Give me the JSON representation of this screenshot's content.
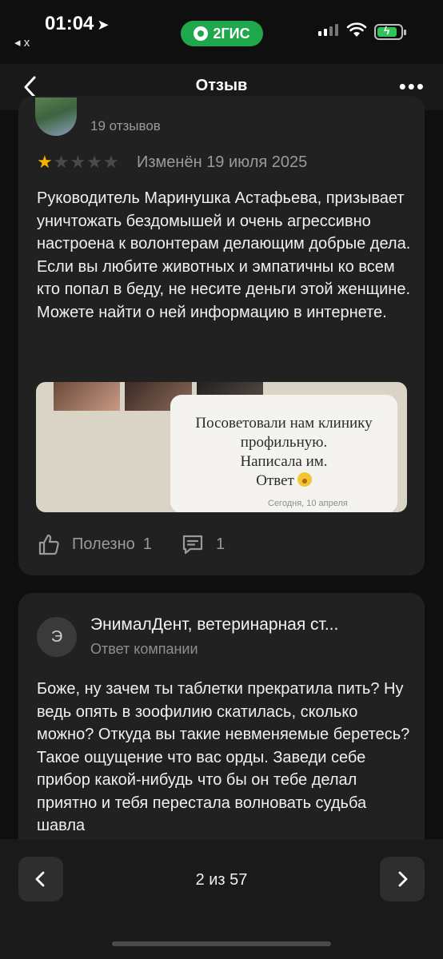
{
  "status_bar": {
    "time": "01:04",
    "back_app": "◂ x",
    "app_badge": "2ГИС"
  },
  "navbar": {
    "title": "Отзыв"
  },
  "review": {
    "reviews_count": "19 отзывов",
    "rating": 1,
    "rating_max": 5,
    "edited": "Изменён 19 июля 2025",
    "text": "Руководитель Маринушка Астафьева, призывает уничтожать бездомышей и очень агрессивно настроена к волонтерам делающим добрые дела. Если вы любите животных и эмпатичны ко всем кто попал в беду, не несите деньги этой женщине. Можете найти о ней информацию в интернете.",
    "image": {
      "message_lines": [
        "Посоветовали нам клинику",
        "профильную.",
        "Написала им.",
        "Ответ"
      ],
      "date": "Сегодня, 10 апреля"
    },
    "useful_label": "Полезно",
    "useful_count": "1",
    "comments_count": "1"
  },
  "company_reply": {
    "avatar_letter": "Э",
    "name": "ЭнималДент, ветеринарная ст...",
    "subtitle": "Ответ компании",
    "text": "Боже, ну зачем ты таблетки прекратила пить? Ну ведь опять в зоофилию скатилась, сколько можно? Откуда вы такие невменяемые беретесь? Такое ощущение что вас орды. Заведи себе прибор какой-нибудь что бы он тебе делал приятно и тебя перестала волновать судьба шавла"
  },
  "pagination": {
    "text": "2 из 57"
  },
  "colors": {
    "background": "#0f0f0f",
    "card": "#212121",
    "star_active": "#f5b400",
    "star_inactive": "#4a4a4a",
    "brand_green": "#1fa84b"
  }
}
